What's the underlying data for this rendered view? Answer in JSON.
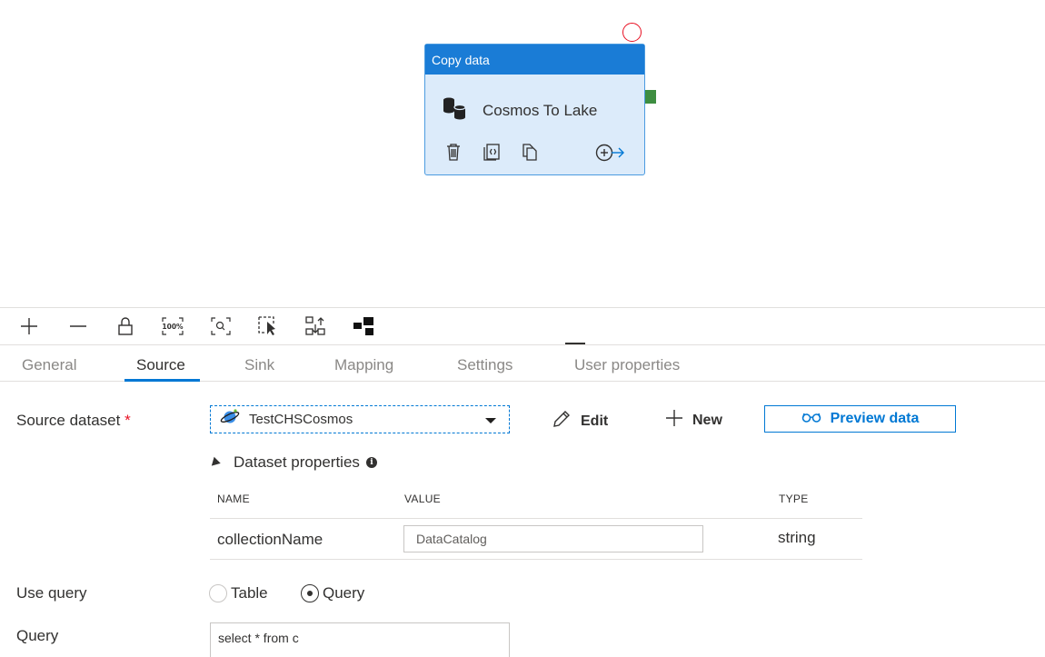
{
  "canvas": {
    "activity": {
      "type_label": "Copy data",
      "name": "Cosmos To Lake"
    }
  },
  "toolbar": {
    "buttons": [
      "add-icon",
      "remove-icon",
      "lock-icon",
      "zoom-100-icon",
      "zoom-fit-icon",
      "select-icon",
      "auto-align-icon",
      "layout-icon"
    ],
    "zoom_text": "100%"
  },
  "tabs": [
    {
      "label": "General",
      "active": false
    },
    {
      "label": "Source",
      "active": true
    },
    {
      "label": "Sink",
      "active": false
    },
    {
      "label": "Mapping",
      "active": false
    },
    {
      "label": "Settings",
      "active": false
    },
    {
      "label": "User properties",
      "active": false
    }
  ],
  "source": {
    "dataset_label": "Source dataset",
    "required_mark": "*",
    "dataset_value": "TestCHSCosmos",
    "edit_label": "Edit",
    "new_label": "New",
    "preview_label": "Preview data",
    "dataset_properties_label": "Dataset properties",
    "columns": [
      "NAME",
      "VALUE",
      "TYPE"
    ],
    "rows": [
      {
        "name": "collectionName",
        "value": "DataCatalog",
        "type": "string"
      }
    ],
    "use_query_label": "Use query",
    "use_query_options": [
      {
        "label": "Table",
        "checked": false
      },
      {
        "label": "Query",
        "checked": true
      }
    ],
    "query_label": "Query",
    "query_value": "select * from c"
  },
  "colors": {
    "accent": "#0078d4",
    "activity_header": "#1a7cd6",
    "activity_body": "#dcebfa",
    "status_error": "#e81123",
    "port": "#3e8e41"
  }
}
